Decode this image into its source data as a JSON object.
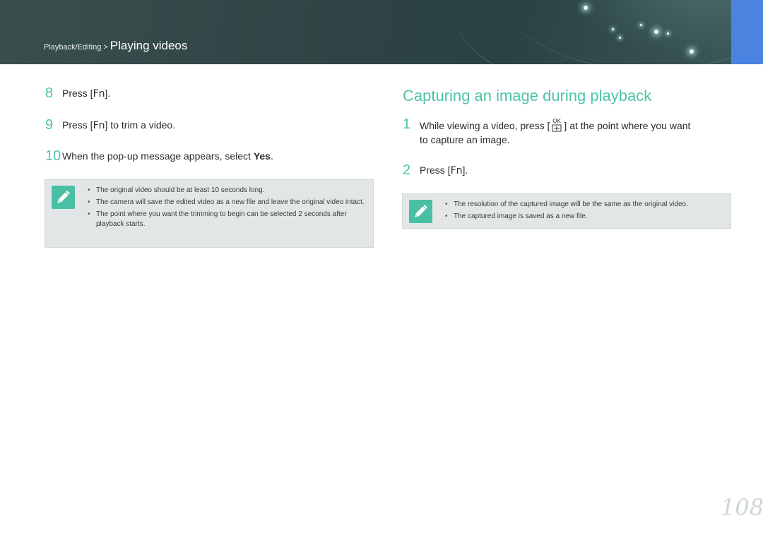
{
  "header": {
    "breadcrumb_parent": "Playback/Editing",
    "breadcrumb_separator": ">",
    "breadcrumb_current": "Playing videos"
  },
  "left": {
    "steps": [
      {
        "num": "8",
        "pre": "Press [",
        "key": "Fn",
        "post": "]."
      },
      {
        "num": "9",
        "pre": "Press [",
        "key": "Fn",
        "post": "] to trim a video."
      },
      {
        "num": "10",
        "pre": "When the pop-up message appears, select ",
        "key": "Yes",
        "post": "."
      }
    ],
    "note_items": [
      "The original video should be at least 10 seconds long.",
      "The camera will save the edited video as a new file and leave the original video intact.",
      "The point where you want the trimming to begin can be selected 2 seconds after playback starts."
    ]
  },
  "right": {
    "title": "Capturing an image during playback",
    "steps": [
      {
        "num": "1",
        "pre": "While viewing a video, press [",
        "post": "] at the point where you want",
        "line2": "to capture an image."
      },
      {
        "num": "2",
        "pre": "Press [",
        "key": "Fn",
        "post": "]."
      }
    ],
    "ok_icon_label": "OK",
    "note_items": [
      "The resolution of the captured image will be the same as the original video.",
      "The captured image is saved as a new file."
    ]
  },
  "page_number": "108",
  "colors": {
    "accent": "#4fc2a8",
    "header_bg": "#2f4444",
    "tab_blue": "#4a83e0",
    "note_bg": "#e3e6e6"
  }
}
